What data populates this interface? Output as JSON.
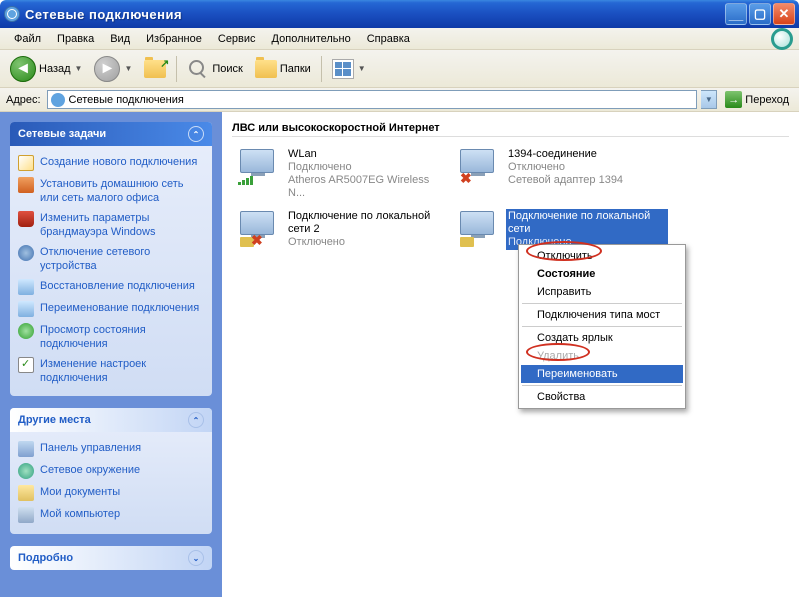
{
  "window": {
    "title": "Сетевые подключения"
  },
  "menubar": [
    "Файл",
    "Правка",
    "Вид",
    "Избранное",
    "Сервис",
    "Дополнительно",
    "Справка"
  ],
  "toolbar": {
    "back": "Назад",
    "search": "Поиск",
    "folders": "Папки"
  },
  "address": {
    "label": "Адрес:",
    "value": "Сетевые подключения",
    "go": "Переход"
  },
  "sidebar": {
    "panels": [
      {
        "title": "Сетевые задачи",
        "items": [
          "Создание нового подключения",
          "Установить домашнюю сеть или сеть малого офиса",
          "Изменить параметры брандмауэра Windows",
          "Отключение сетевого устройства",
          "Восстановление подключения",
          "Переименование подключения",
          "Просмотр состояния подключения",
          "Изменение настроек подключения"
        ]
      },
      {
        "title": "Другие места",
        "items": [
          "Панель управления",
          "Сетевое окружение",
          "Мои документы",
          "Мой компьютер"
        ]
      },
      {
        "title": "Подробно",
        "items": []
      }
    ]
  },
  "content": {
    "section": "ЛВС или высокоскоростной Интернет",
    "items": [
      {
        "name": "WLan",
        "status": "Подключено",
        "detail": "Atheros AR5007EG Wireless N..."
      },
      {
        "name": "1394-соединение",
        "status": "Отключено",
        "detail": "Сетевой адаптер 1394"
      },
      {
        "name": "Подключение по локальной сети 2",
        "status": "Отключено",
        "detail": ""
      },
      {
        "name": "Подключение по локальной сети",
        "status": "Подключено",
        "detail": ""
      }
    ]
  },
  "context_menu": {
    "items": [
      {
        "label": "Отключить",
        "type": "item"
      },
      {
        "label": "Состояние",
        "type": "bold"
      },
      {
        "label": "Исправить",
        "type": "item"
      },
      {
        "type": "sep"
      },
      {
        "label": "Подключения типа мост",
        "type": "item"
      },
      {
        "type": "sep"
      },
      {
        "label": "Создать ярлык",
        "type": "item"
      },
      {
        "label": "Удалить",
        "type": "disabled"
      },
      {
        "label": "Переименовать",
        "type": "highlight"
      },
      {
        "type": "sep"
      },
      {
        "label": "Свойства",
        "type": "item"
      }
    ]
  }
}
